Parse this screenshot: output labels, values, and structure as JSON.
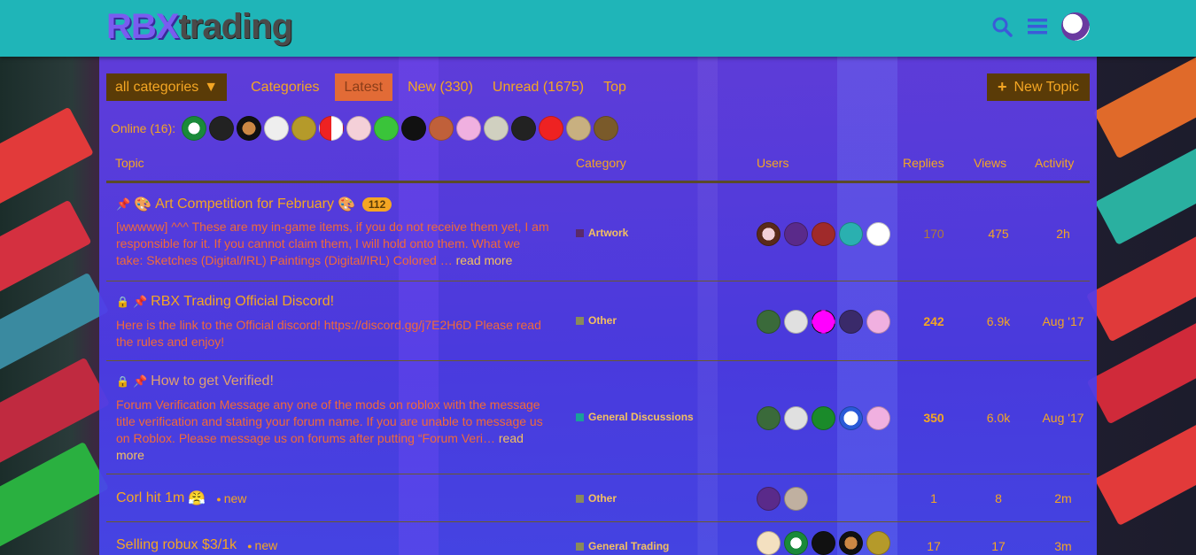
{
  "header": {
    "logo_part1": "RBX",
    "logo_part2": "trading"
  },
  "nav": {
    "all_categories": "all categories",
    "links": [
      {
        "label": "Categories"
      },
      {
        "label": "Latest"
      },
      {
        "label": "New (330)"
      },
      {
        "label": "Unread (1675)"
      },
      {
        "label": "Top"
      }
    ],
    "new_topic": "New Topic"
  },
  "online": {
    "label": "Online (16):"
  },
  "table": {
    "headers": {
      "topic": "Topic",
      "category": "Category",
      "users": "Users",
      "replies": "Replies",
      "views": "Views",
      "activity": "Activity"
    },
    "rows": [
      {
        "title": "Art Competition for February",
        "badge": "112",
        "excerpt": "[wwwww] ^^^ These are my in-game items, if you do not receive them yet, I am responsible for it. If you cannot claim them, I will hold onto them. What we take: Sketches (Digital/IRL) Paintings (Digital/IRL) Colored …",
        "read_more": "read more",
        "category": "Artwork",
        "category_color": "#5a2a6a",
        "replies": "170",
        "views": "475",
        "activity": "2h"
      },
      {
        "title": "RBX Trading Official Discord!",
        "excerpt": "Here is the link to the Official discord! https://discord.gg/j7E2H6D Please read the rules and enjoy!",
        "category": "Other",
        "category_color": "#8a8a5a",
        "replies": "242",
        "views": "6.9k",
        "activity": "Aug '17"
      },
      {
        "title": "How to get Verified!",
        "excerpt": "Forum Verification Message any one of the mods on roblox with the message title verification and stating your forum name. If you are unable to message us on Roblox. Please message us on forums after putting “Forum Veri…",
        "read_more": "read more",
        "category": "General Discussions",
        "category_color": "#1aa09a",
        "replies": "350",
        "views": "6.0k",
        "activity": "Aug '17"
      },
      {
        "title": "Corl hit 1m",
        "new_label": "new",
        "category": "Other",
        "category_color": "#8a8a5a",
        "replies": "1",
        "views": "8",
        "activity": "2m"
      },
      {
        "title": "Selling robux $3/1k",
        "new_label": "new",
        "category": "General Trading",
        "category_color": "#8a8a5a",
        "replies": "17",
        "views": "17",
        "activity": "3m"
      }
    ]
  }
}
